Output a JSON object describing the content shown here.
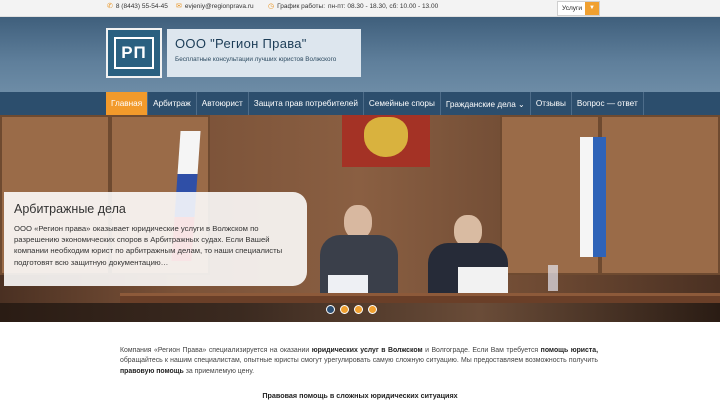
{
  "topbar": {
    "phone": "8 (8443) 55-54-45",
    "phone_icon": "phone-icon",
    "email": "evjeniy@regionprava.ru",
    "email_icon": "mail-icon",
    "schedule_label": "График работы:",
    "schedule_value": "пн-пт: 08.30 - 18.30, сб: 10.00 - 13.00",
    "schedule_icon": "clock-icon",
    "services_select": "Услуги"
  },
  "header": {
    "logo_text": "РП",
    "company_name": "ООО \"Регион Права\"",
    "tagline": "Бесплатные консультации лучших юристов Волжского"
  },
  "nav": {
    "items": [
      {
        "label": "Главная"
      },
      {
        "label": "Арбитраж"
      },
      {
        "label": "Автоюрист"
      },
      {
        "label": "Защита прав потребителей"
      },
      {
        "label": "Семейные споры"
      },
      {
        "label": "Гражданские дела ⌄"
      },
      {
        "label": "Отзывы"
      },
      {
        "label": "Вопрос — ответ"
      }
    ],
    "active_index": 0
  },
  "slider": {
    "title": "Арбитражные дела",
    "text": "ООО «Регион права» оказывает юридические услуги в Волжском по разрешению экономических споров в Арбитражных судах. Если Вашей компании необходим юрист по арбитражным делам, то наши специалисты подготовят всю защитную документацию…",
    "slide_count": 4,
    "active_slide": 1
  },
  "content": {
    "intro": {
      "p1": "Компания «Регион Права» специализируется на оказании ",
      "b1": "юридических услуг в Волжском",
      "p2": " и Волгограде. Если Вам требуется ",
      "b2": "помощь юриста,",
      "p3": " обращайтесь к нашим специалистам, опытные юристы смогут урегулировать самую сложную ситуацию. Мы предоставляем возможность получить ",
      "b3": "правовую помощь",
      "p4": " за приемлемую цену."
    },
    "section_heading": "Правовая помощь в сложных юридических ситуациях"
  },
  "colors": {
    "accent": "#f29a2b",
    "nav_bg": "#2c4e6d",
    "header_bg": "#5f7f9b"
  }
}
